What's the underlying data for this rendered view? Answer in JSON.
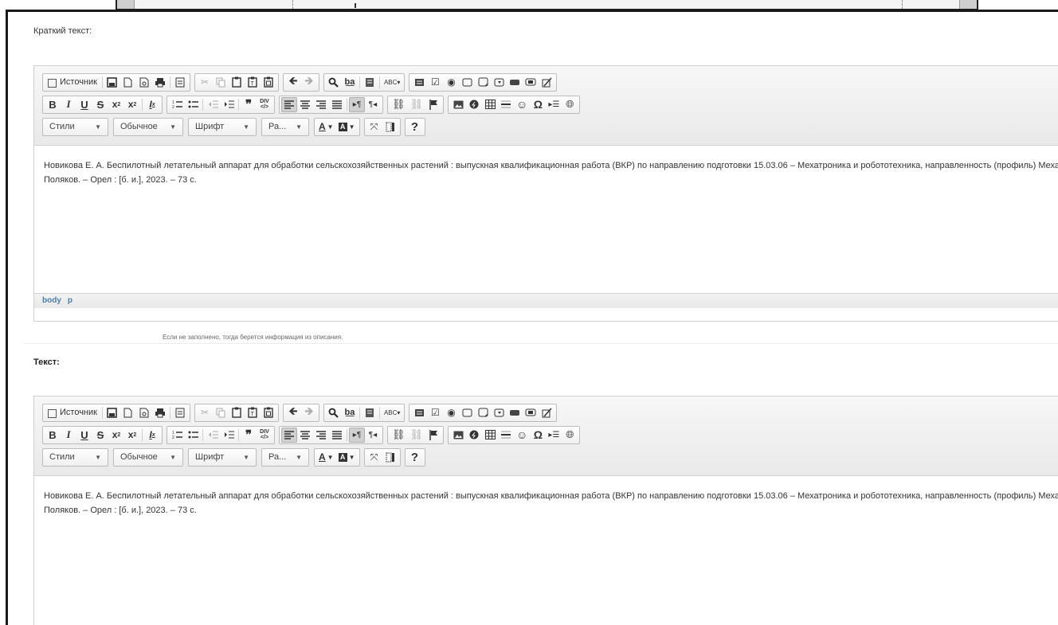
{
  "form": {
    "short_text_label": "Краткий текст:",
    "text_label": "Текст:",
    "short_text_hint": "Если не заполнено, тогда берется информация из описания."
  },
  "toolbar": {
    "source_label": "Источник",
    "styles_label": "Стили",
    "format_label": "Обычное",
    "font_label": "Шрифт",
    "size_label": "Ра...",
    "bold": "B",
    "italic": "I",
    "underline": "U",
    "strike": "S",
    "help": "?"
  },
  "editor1": {
    "content_line1": "Новикова Е. А. Беспилотный летательный аппарат для обработки сельскохозяйственных растений : выпускная квалификационная работа (ВКР) по направлению подготовки 15.03.06 – Мехатроника и робототехника, направленность (профиль) Мехатроника / Е. А. Новикова ; рук. С. А. Поляков",
    "content_line2": "Поляков. – Орел : [б. и.], 2023. – 73 с.",
    "path": [
      "body",
      "p"
    ]
  },
  "editor2": {
    "content_line1": "Новикова Е. А. Беспилотный летательный аппарат для обработки сельскохозяйственных растений : выпускная квалификационная работа (ВКР) по направлению подготовки 15.03.06 – Мехатроника и робототехника, направленность (профиль) Мехатроника / Е. А. Новикова ; рук. С. А. Поляков",
    "content_line2": "Поляков. – Орел : [б. и.], 2023. – 73 с."
  }
}
